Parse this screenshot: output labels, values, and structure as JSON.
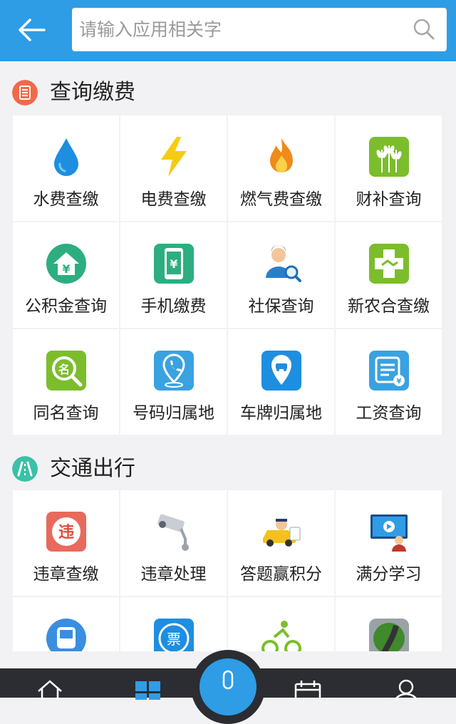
{
  "search": {
    "placeholder": "请输入应用相关字"
  },
  "sections": [
    {
      "title": "查询缴费",
      "items": [
        {
          "label": "水费查缴",
          "icon": "water-drop-icon"
        },
        {
          "label": "电费查缴",
          "icon": "lightning-icon"
        },
        {
          "label": "燃气费查缴",
          "icon": "flame-icon"
        },
        {
          "label": "财补查询",
          "icon": "wheat-icon"
        },
        {
          "label": "公积金查询",
          "icon": "house-yuan-icon"
        },
        {
          "label": "手机缴费",
          "icon": "phone-yuan-icon"
        },
        {
          "label": "社保查询",
          "icon": "person-search-icon"
        },
        {
          "label": "新农合查缴",
          "icon": "medical-cross-icon"
        },
        {
          "label": "同名查询",
          "icon": "name-search-icon"
        },
        {
          "label": "号码归属地",
          "icon": "phone-location-icon"
        },
        {
          "label": "车牌归属地",
          "icon": "car-location-icon"
        },
        {
          "label": "工资查询",
          "icon": "salary-list-icon"
        }
      ]
    },
    {
      "title": "交通出行",
      "items": [
        {
          "label": "违章查缴",
          "icon": "violation-icon",
          "glyph": "违"
        },
        {
          "label": "违章处理",
          "icon": "camera-icon"
        },
        {
          "label": "答题赢积分",
          "icon": "police-car-icon"
        },
        {
          "label": "满分学习",
          "icon": "teacher-screen-icon"
        },
        {
          "label": "",
          "icon": "bus-icon"
        },
        {
          "label": "",
          "icon": "ticket-icon",
          "glyph": "票"
        },
        {
          "label": "",
          "icon": "bicycle-icon"
        },
        {
          "label": "",
          "icon": "road-icon"
        }
      ]
    }
  ],
  "colors": {
    "primary": "#2e9de6",
    "section1_icon": "#f06a4a",
    "section2_icon": "#3cc0a8",
    "bottom_bar": "#2b2d33"
  }
}
